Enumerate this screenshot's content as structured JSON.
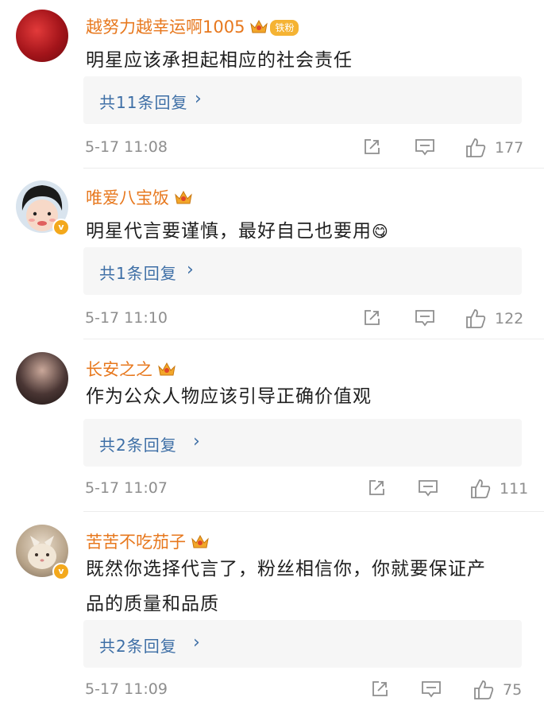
{
  "comments": [
    {
      "username": "越努力越幸运啊1005",
      "fan_badge": "铁粉",
      "text": "明星应该承担起相应的社会责任",
      "reply_label": "共11条回复",
      "time": "5-17 11:08",
      "likes": "177"
    },
    {
      "username": "唯爱八宝饭",
      "text": "明星代言要谨慎，最好自己也要用",
      "emoji": "😋",
      "reply_label": "共1条回复",
      "time": "5-17 11:10",
      "likes": "122"
    },
    {
      "username": "长安之之",
      "text": "作为公众人物应该引导正确价值观",
      "reply_label": "共2条回复",
      "time": "5-17 11:07",
      "likes": "111"
    },
    {
      "username": "苦苦不吃茄子",
      "text_line1": "既然你选择代言了，粉丝相信你，你就要保证产",
      "text_line2": "品的质量和品质",
      "reply_label": "共2条回复",
      "time": "5-17 11:09",
      "likes": "75"
    }
  ],
  "icons": {
    "share": "share-icon",
    "comment": "comment-icon",
    "like": "thumbs-up-icon",
    "crown": "crown-badge-icon",
    "verified": "verified-v-icon"
  },
  "colors": {
    "username": "#e7781e",
    "reply_link": "#3e6fa6",
    "meta_text": "#8e8e8e",
    "badge": "#f5b333"
  }
}
